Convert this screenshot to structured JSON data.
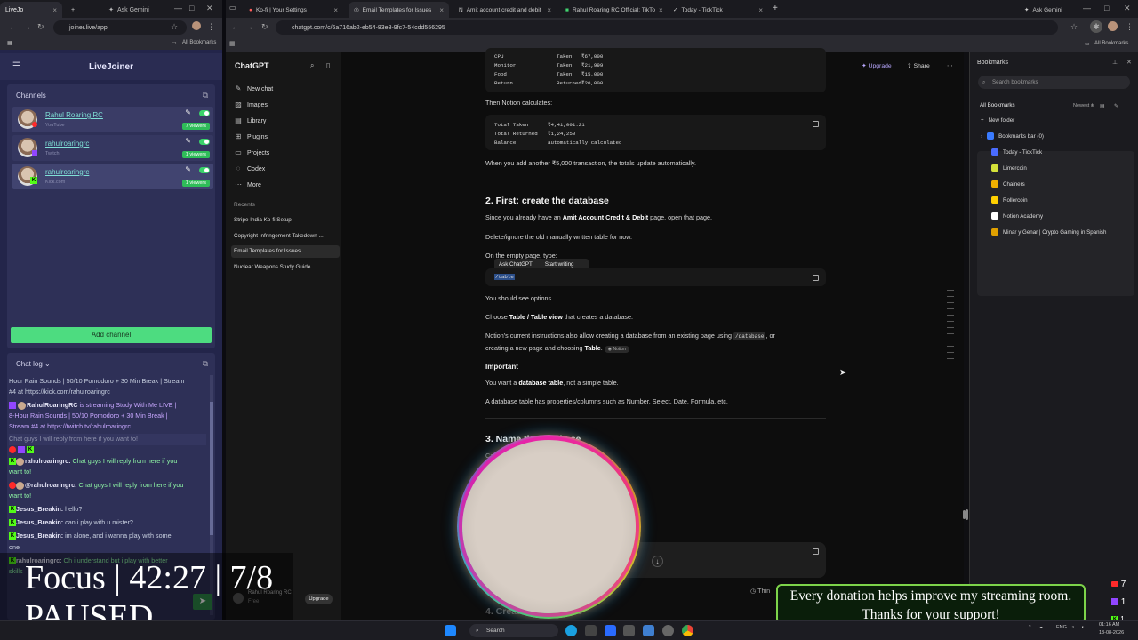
{
  "left_browser": {
    "tabs": [
      {
        "label": "LiveJo"
      },
      {
        "label": "Ask Gemini"
      }
    ],
    "url": "joiner.live/app",
    "bookmarks_label": "All Bookmarks"
  },
  "livejoiner": {
    "title": "LiveJoiner",
    "channels_title": "Channels",
    "channels": [
      {
        "name": "Rahul Roaring RC",
        "platform": "YouTube",
        "viewers": "7 viewers"
      },
      {
        "name": "rahulroaringrc",
        "platform": "Twitch",
        "viewers": "1 viewers"
      },
      {
        "name": "rahulroaringrc",
        "platform": "Kick.com",
        "viewers": "1 viewers"
      }
    ],
    "add_channel": "Add channel",
    "chatlog_title": "Chat log",
    "chat": [
      {
        "text": "Hour Rain Sounds | 50/10 Pomodoro + 30 Min Break | Stream"
      },
      {
        "text": "#4 at https://kick.com/rahulroaringrc"
      },
      {
        "user": "RahulRoaringRC",
        "text": " is streaming Study With Me LIVE |"
      },
      {
        "text": "8-Hour Rain Sounds | 50/10 Pomodoro + 30 Min Break |"
      },
      {
        "text": "Stream #4 at https://twitch.tv/rahulroaringrc"
      },
      {
        "text": "Chat guys I will reply from here if you want to!"
      },
      {
        "user": "rahulroaringrc:",
        "text": " Chat guys I will reply from here if you"
      },
      {
        "text": "want to!"
      },
      {
        "user": "@rahulroaringrc:",
        "text": " Chat guys I will reply from here if you"
      },
      {
        "text": "want to!"
      },
      {
        "user": "Jesus_Breakin:",
        "text": " hello?"
      },
      {
        "user": "Jesus_Breakin:",
        "text": " can i play with u mister?"
      },
      {
        "user": "Jesus_Breakin:",
        "text": " im alone, and i wanna play with some"
      },
      {
        "text": "one"
      },
      {
        "user": "rahulroaringrc:",
        "text": " Oh i understand but i play with better"
      },
      {
        "text": "skills"
      }
    ]
  },
  "main_browser": {
    "tabs": [
      {
        "label": "Ko-fi | Your Settings"
      },
      {
        "label": "Email Templates for Issues"
      },
      {
        "label": "Amit account credit and debit"
      },
      {
        "label": "Rahul Roaring RC Official: TikTo"
      },
      {
        "label": "Today - TickTick"
      }
    ],
    "gemini": "Ask Gemini",
    "url": "chatgpt.com/c/6a716ab2-eb54-83e8-9fc7-54cdd556295",
    "all_bookmarks": "All Bookmarks"
  },
  "chatgpt": {
    "brand": "ChatGPT",
    "nav": [
      "New chat",
      "Images",
      "Library",
      "Plugins",
      "Projects",
      "Codex",
      "More"
    ],
    "recents_label": "Recents",
    "recents": [
      "Stripe India Ko-fi Setup",
      "Copyright Infringement Takedown ...",
      "Email Templates for Issues",
      "Nuclear Weapons Study Guide"
    ],
    "user_name": "Rahul Roaring RC",
    "user_plan": "Free",
    "upgrade_pill": "Upgrade",
    "top_upgrade": "Upgrade",
    "top_share": "Share"
  },
  "conversation": {
    "code1_rows": [
      [
        "CPU",
        "Taken",
        "₹67,000"
      ],
      [
        "Monitor",
        "Taken",
        "₹21,999"
      ],
      [
        "Food",
        "Taken",
        "₹15,000"
      ],
      [
        "Return",
        "Returned",
        "₹20,000"
      ]
    ],
    "p_notion_calc": "Then Notion calculates:",
    "code2_rows": [
      [
        "Total Taken",
        "₹4,41,001.21"
      ],
      [
        "Total Returned",
        "₹1,24,250"
      ],
      [
        "Balance",
        "automatically calculated"
      ]
    ],
    "p_add": "When you add another ₹5,000 transaction, the totals update automatically.",
    "h_first": "2. First: create the database",
    "p_since_a": "Since you already have an ",
    "p_since_b": "Amit Account Credit & Debit",
    "p_since_c": " page, open that page.",
    "p_delete": "Delete/ignore the old manually written table for now.",
    "p_empty": "On the empty page, type:",
    "popup_ask": "Ask ChatGPT",
    "popup_write": "Start writing",
    "code3": "/table",
    "p_options": "You should see options.",
    "p_choose_a": "Choose ",
    "p_choose_b": "Table / Table view",
    "p_choose_c": " that creates a database.",
    "p_notion_a": "Notion's current instructions also allow creating a database from an existing page using ",
    "p_notion_code": "/database",
    "p_notion_b": ", or",
    "p_notion2_a": "creating a new page and choosing ",
    "p_notion2_b": "Table",
    "p_notion2_c": ".",
    "notion_badge": "Notion",
    "h_important": "Important",
    "p_want_a": "You want a ",
    "p_want_b": "database table",
    "p_want_c": ", not a simple table.",
    "p_props": "A database table has properties/columns such as Number, Select, Date, Formula, etc.",
    "h_name": "3. Name the database",
    "p_call": "Call",
    "p_think": "Thin",
    "h_next": "4. Create the columns"
  },
  "bookmarks_panel": {
    "title": "Bookmarks",
    "search_placeholder": "Search bookmarks",
    "all_label": "All Bookmarks",
    "sort_label": "Newest",
    "new_folder": "New folder",
    "items": [
      {
        "label": "Bookmarks bar (0)",
        "color": "#3a7bff"
      },
      {
        "label": "Today - TickTick",
        "color": "#4a6cff"
      },
      {
        "label": "Limercoin",
        "color": "#d5e23a"
      },
      {
        "label": "Chainers",
        "color": "#f0b000"
      },
      {
        "label": "Rollercoin",
        "color": "#ffd000"
      },
      {
        "label": "Notion Academy",
        "color": "#ffffff"
      },
      {
        "label": "Minar y Genar | Crypto Gaming in Spanish",
        "color": "#e0a000"
      }
    ]
  },
  "overlay": {
    "focus_line": "Focus | 42:27 | 7/8",
    "paused": "PAUSED",
    "donation_1": "Every donation helps improve my streaming room.",
    "donation_2": "Thanks for your support!",
    "yt_count": "7",
    "tw_count": "1",
    "kick_count": "1"
  },
  "taskbar": {
    "search": "Search",
    "lang": "ENG",
    "time": "01:16 AM",
    "date": "13-08-2026"
  }
}
